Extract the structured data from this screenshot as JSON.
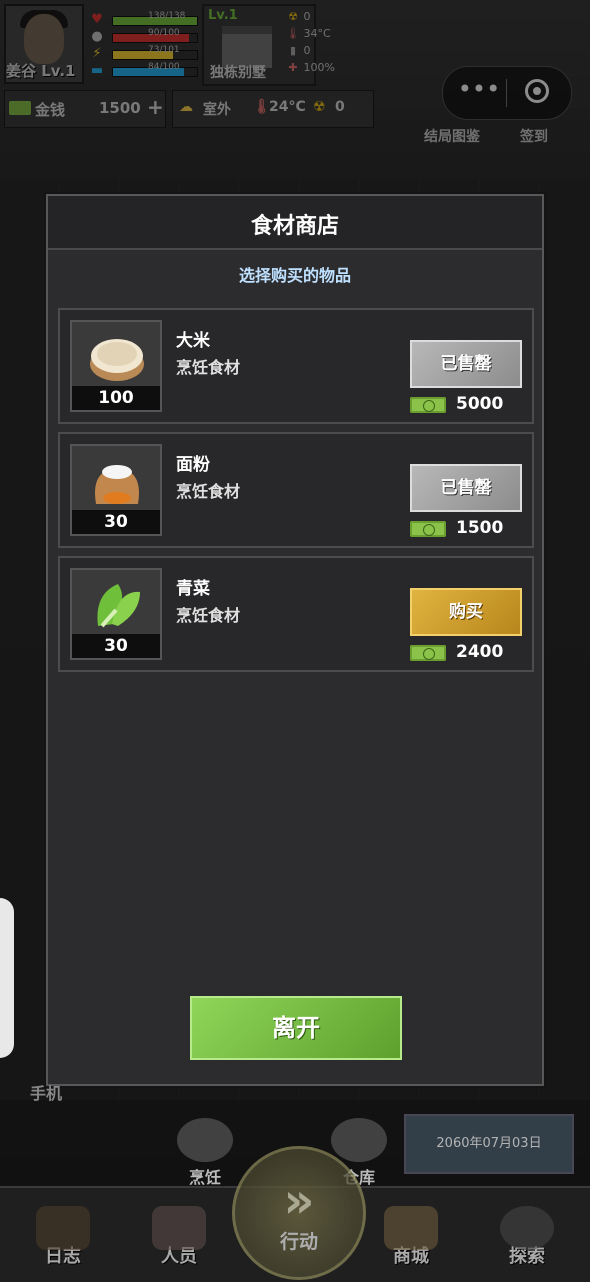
{
  "hud": {
    "player_name": "姜谷 Lv.1",
    "stats": [
      {
        "icon": "heart-icon",
        "text": "138/138",
        "color": "#7ac943",
        "level": 1.0
      },
      {
        "icon": "stomach-icon",
        "text": "90/100",
        "color": "#e53935",
        "level": 0.9
      },
      {
        "icon": "energy-icon",
        "text": "73/101",
        "color": "#fdd835",
        "level": 0.72
      },
      {
        "icon": "water-icon",
        "text": "84/100",
        "color": "#29b6f6",
        "level": 0.84
      }
    ],
    "location_level": "Lv.1",
    "location_name": "独栋别墅",
    "env": {
      "radiation": "0",
      "temperature": "34°C",
      "unknown": "0",
      "percent": "100%"
    },
    "money_label": "金钱",
    "money_value": "1500",
    "money_plus": "+",
    "weather_label": "室外",
    "weather_temp": "24°C",
    "weather_rad": "0",
    "link_archive": "结局图鉴",
    "link_checkin": "签到"
  },
  "shop": {
    "title": "食材商店",
    "subtitle": "选择购买的物品",
    "items": [
      {
        "name": "大米",
        "type": "烹饪食材",
        "qty": "100",
        "button": "已售罄",
        "state": "sold",
        "price": "5000",
        "art": "rice-sack"
      },
      {
        "name": "面粉",
        "type": "烹饪食材",
        "qty": "30",
        "button": "已售罄",
        "state": "sold",
        "price": "1500",
        "art": "flour-sack"
      },
      {
        "name": "青菜",
        "type": "烹饪食材",
        "qty": "30",
        "button": "购买",
        "state": "buy",
        "price": "2400",
        "art": "bok-choy"
      }
    ],
    "leave": "离开"
  },
  "bottom": {
    "nav": [
      "日志",
      "人员",
      "商城",
      "探索"
    ],
    "action": "行动",
    "cook": "烹饪",
    "storage": "仓库",
    "date": "2060年07月03日",
    "phone": "手机"
  },
  "colors": {
    "sold_button": "#9e9e9e",
    "buy_button": "#d4a32e",
    "leave_button": "#7cc444",
    "subtitle": "#bfe0ff"
  }
}
